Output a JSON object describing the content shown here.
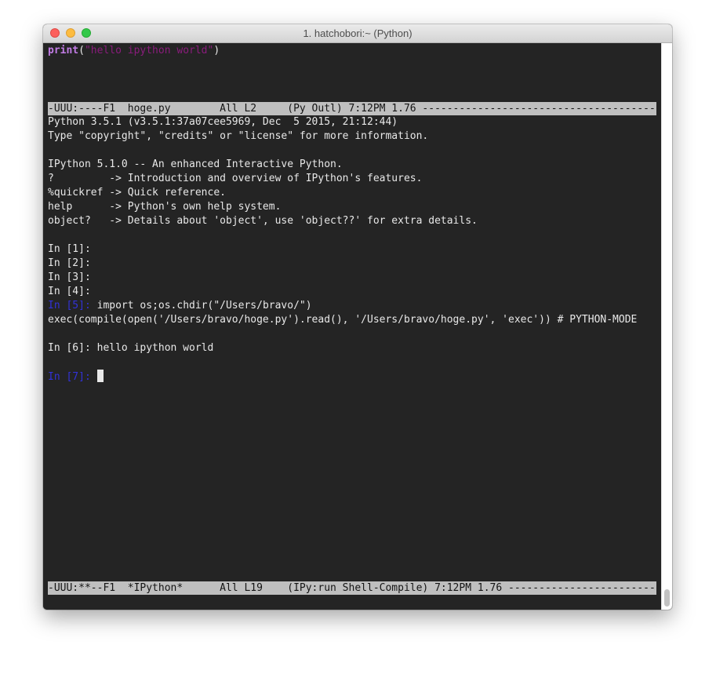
{
  "window": {
    "title": "1. hatchobori:~  (Python)"
  },
  "editor": {
    "code_func": "print",
    "code_open": "(",
    "code_string": "\"hello ipython world\"",
    "code_close": ")"
  },
  "modeline_top": "-UUU:----F1  hoge.py        All L2     (Py Outl) 7:12PM 1.76 -------------------------------------------",
  "shell": {
    "banner": [
      "Python 3.5.1 (v3.5.1:37a07cee5969, Dec  5 2015, 21:12:44)",
      "Type \"copyright\", \"credits\" or \"license\" for more information.",
      "",
      "IPython 5.1.0 -- An enhanced Interactive Python.",
      "?         -> Introduction and overview of IPython's features.",
      "%quickref -> Quick reference.",
      "help      -> Python's own help system.",
      "object?   -> Details about 'object', use 'object??' for extra details."
    ],
    "prompts": [
      "In [1]:",
      "In [2]:",
      "In [3]:",
      "In [4]:"
    ],
    "prompt5": "In [5]:",
    "prompt5_cmd": " import os;os.chdir(\"/Users/bravo/\")",
    "exec_line": "exec(compile(open('/Users/bravo/hoge.py').read(), '/Users/bravo/hoge.py', 'exec')) # PYTHON-MODE",
    "prompt6": "In [6]: hello ipython world",
    "prompt7": "In [7]:"
  },
  "modeline_bottom": "-UUU:**--F1  *IPython*      All L19    (IPy:run Shell-Compile) 7:12PM 1.76 -----------------------------",
  "colors": {
    "background": "#242424",
    "modeline_bg": "#bfbfbf",
    "keyword": "#c27ce6",
    "string": "#8a1c7c",
    "prompt_blue": "#3232d8"
  }
}
